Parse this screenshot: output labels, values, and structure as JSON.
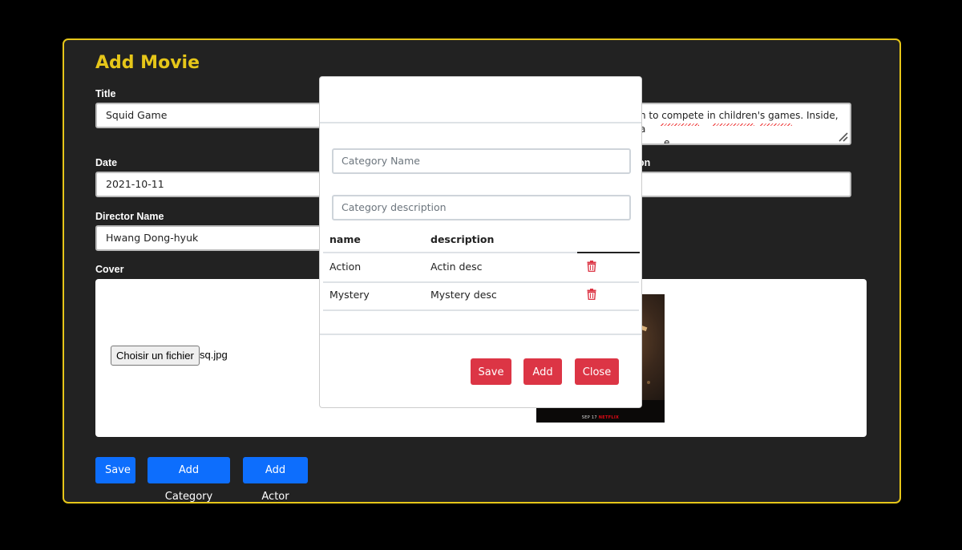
{
  "page": {
    "title": "Add Movie"
  },
  "form": {
    "title_label": "Title",
    "title_value": "Squid Game",
    "description_value_visible": "n to compete in children's games. Inside, a",
    "description_value_line2": "e.",
    "date_label": "Date",
    "date_value": "2021-10-11",
    "right_label_partial": "on",
    "director_label": "Director Name",
    "director_value": " Hwang Dong-hyuk",
    "cover_label": "Cover",
    "file_button_label": "Choisir un fichier",
    "file_name": "sq.jpg",
    "poster_footer_date": "SEP 17",
    "poster_footer_brand": "NETFLIX"
  },
  "actions": {
    "save_label": "Save",
    "add_category_label": "Add Category",
    "add_actor_label": "Add Actor"
  },
  "modal": {
    "category_name_placeholder": "Category Name",
    "category_description_placeholder": "Category description",
    "table": {
      "headers": [
        "name",
        "description",
        ""
      ],
      "rows": [
        {
          "name": "Action",
          "description": "Actin desc"
        },
        {
          "name": "Mystery",
          "description": "Mystery desc"
        }
      ]
    },
    "save_label": "Save",
    "add_label": "Add",
    "close_label": "Close"
  },
  "colors": {
    "accent_yellow": "#e6c619",
    "primary_blue": "#0d6efd",
    "danger_red": "#dc3545",
    "card_bg": "#222222"
  },
  "icons": {
    "row_delete": "trash-icon",
    "textarea_resize": "resize-grip-icon"
  }
}
